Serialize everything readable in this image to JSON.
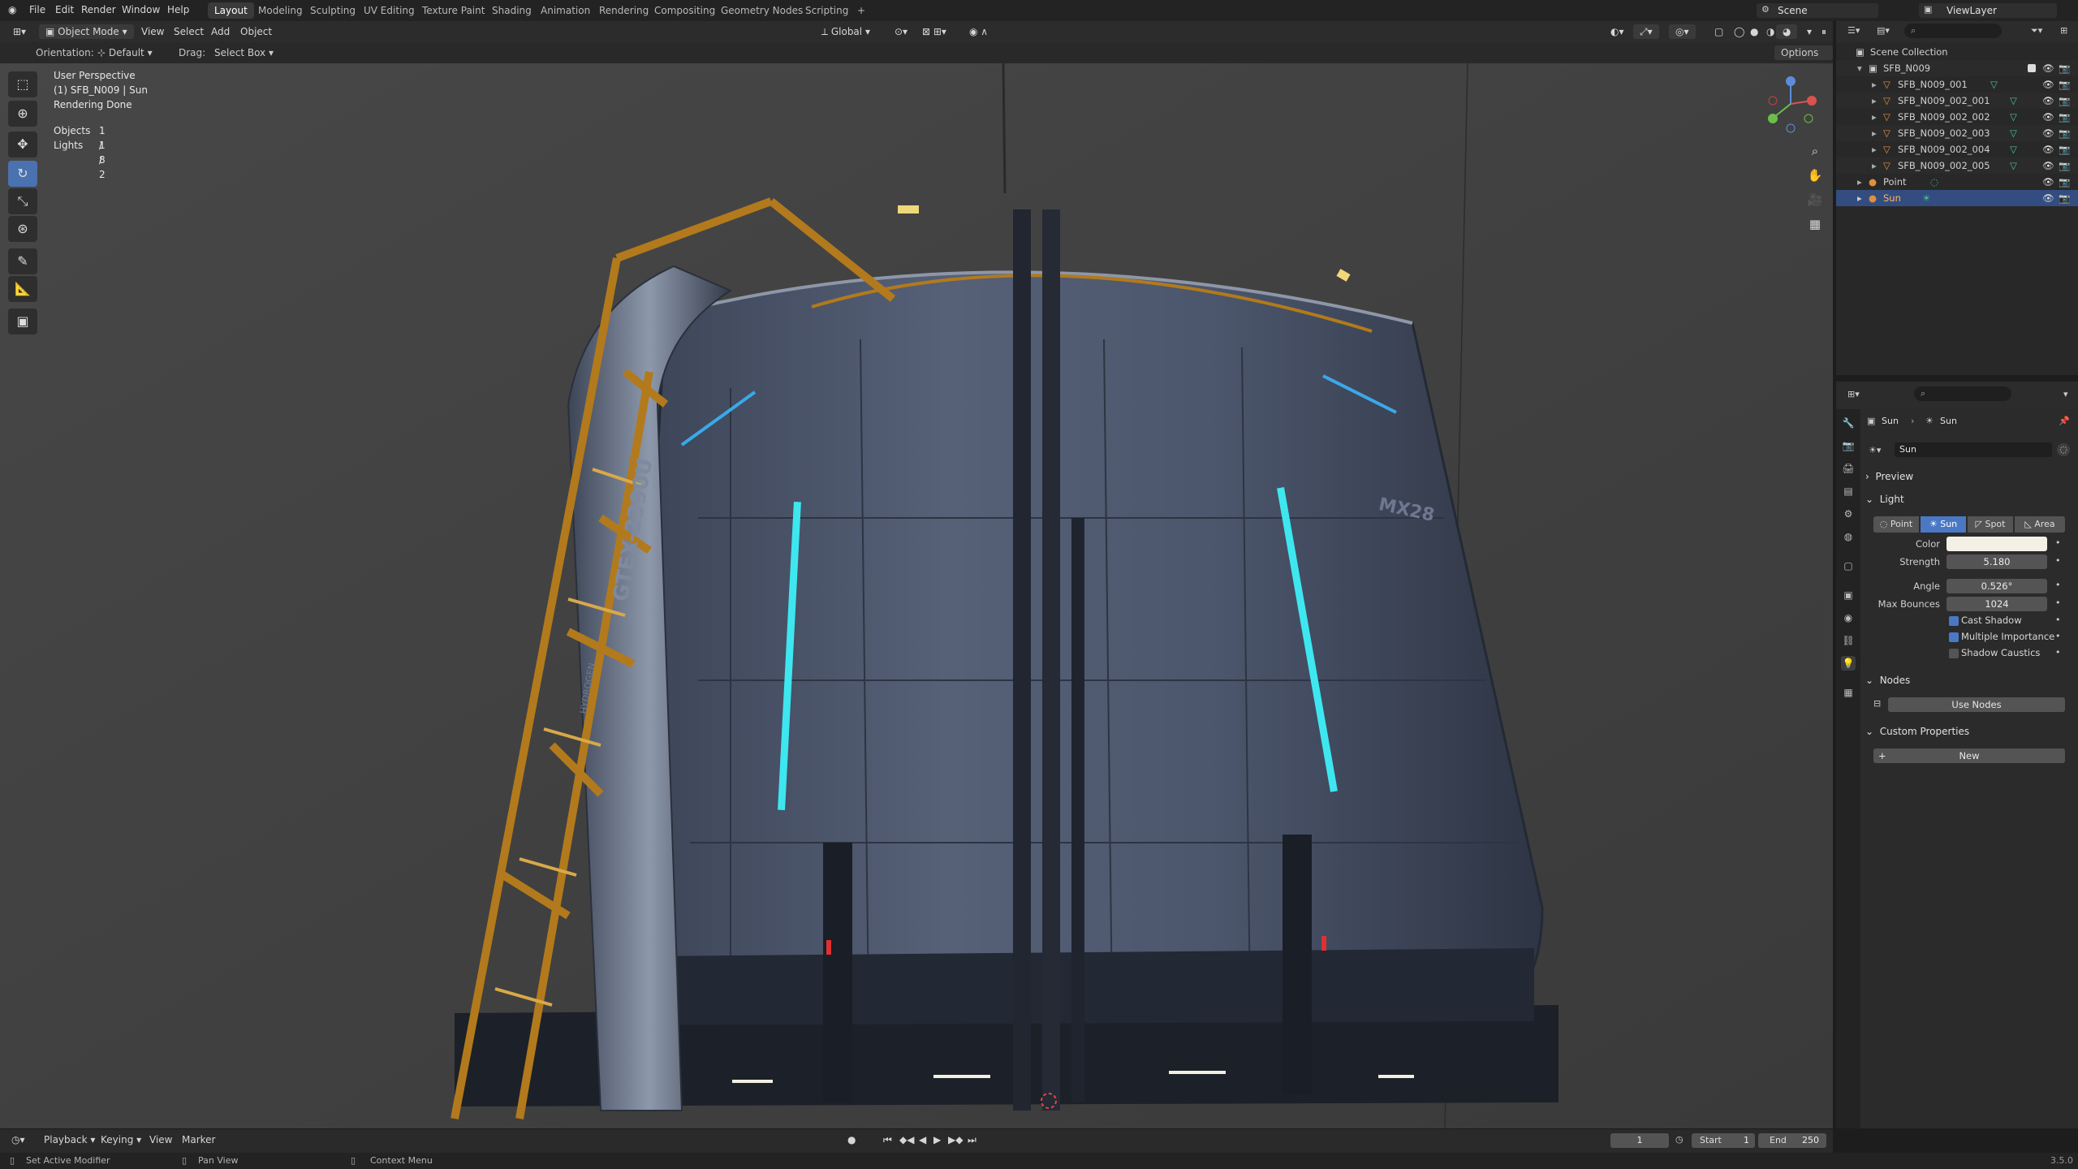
{
  "menu": {
    "items": [
      "File",
      "Edit",
      "Render",
      "Window",
      "Help"
    ],
    "workspaces": [
      "Layout",
      "Modeling",
      "Sculpting",
      "UV Editing",
      "Texture Paint",
      "Shading",
      "Animation",
      "Rendering",
      "Compositing",
      "Geometry Nodes",
      "Scripting"
    ],
    "active_workspace": "Layout",
    "add_tab_icon": "+",
    "scene_name": "Scene",
    "view_layer": "ViewLayer"
  },
  "header": {
    "mode": "Object Mode",
    "view": "View",
    "select": "Select",
    "add": "Add",
    "object": "Object",
    "transform_orientation": "Global",
    "orientation_label": "Orientation:",
    "orientation_value": "Default",
    "drag_label": "Drag:",
    "drag_value": "Select Box",
    "options": "Options"
  },
  "viewport": {
    "perspective": "User Perspective",
    "active_object": "(1) SFB_N009 | Sun",
    "status": "Rendering Done",
    "objects_label": "Objects",
    "objects_value": "1 / 8",
    "lights_label": "Lights",
    "lights_value": "1 / 2",
    "decals": [
      "GTEX-2390U",
      "HYDROGEN",
      "MX28"
    ]
  },
  "outliner": {
    "root": "Scene Collection",
    "collection": "SFB_N009",
    "items": [
      {
        "name": "SFB_N009_001"
      },
      {
        "name": "SFB_N009_002_001"
      },
      {
        "name": "SFB_N009_002_002"
      },
      {
        "name": "SFB_N009_002_003"
      },
      {
        "name": "SFB_N009_002_004"
      },
      {
        "name": "SFB_N009_002_005"
      }
    ],
    "point": "Point",
    "sun": "Sun"
  },
  "properties": {
    "breadcrumb_object": "Sun",
    "breadcrumb_data": "Sun",
    "data_name": "Sun",
    "preview": "Preview",
    "light_panel": "Light",
    "light_types": [
      "Point",
      "Sun",
      "Spot",
      "Area"
    ],
    "active_type": "Sun",
    "color_label": "Color",
    "color_value": "#f4f0e6",
    "strength_label": "Strength",
    "strength_value": "5.180",
    "angle_label": "Angle",
    "angle_value": "0.526°",
    "bounces_label": "Max Bounces",
    "bounces_value": "1024",
    "cast_shadow": "Cast Shadow",
    "multiple_importance": "Multiple Importance",
    "shadow_caustics": "Shadow Caustics",
    "nodes_panel": "Nodes",
    "use_nodes": "Use Nodes",
    "custom_props": "Custom Properties",
    "new_button": "New"
  },
  "timeline": {
    "playback": "Playback",
    "keying": "Keying",
    "view": "View",
    "marker": "Marker",
    "current_frame": "1",
    "start_label": "Start",
    "start_value": "1",
    "end_label": "End",
    "end_value": "250"
  },
  "statusbar": {
    "left": "Set Active Modifier",
    "middle": "Pan View",
    "right": "Context Menu",
    "version": "3.5.0"
  },
  "colors": {
    "accent": "#4a78c4",
    "selection": "#334d80",
    "tank_body": "#4a5568",
    "rail_orange": "#b27a1c",
    "cyan_light": "#3ee7f0"
  }
}
